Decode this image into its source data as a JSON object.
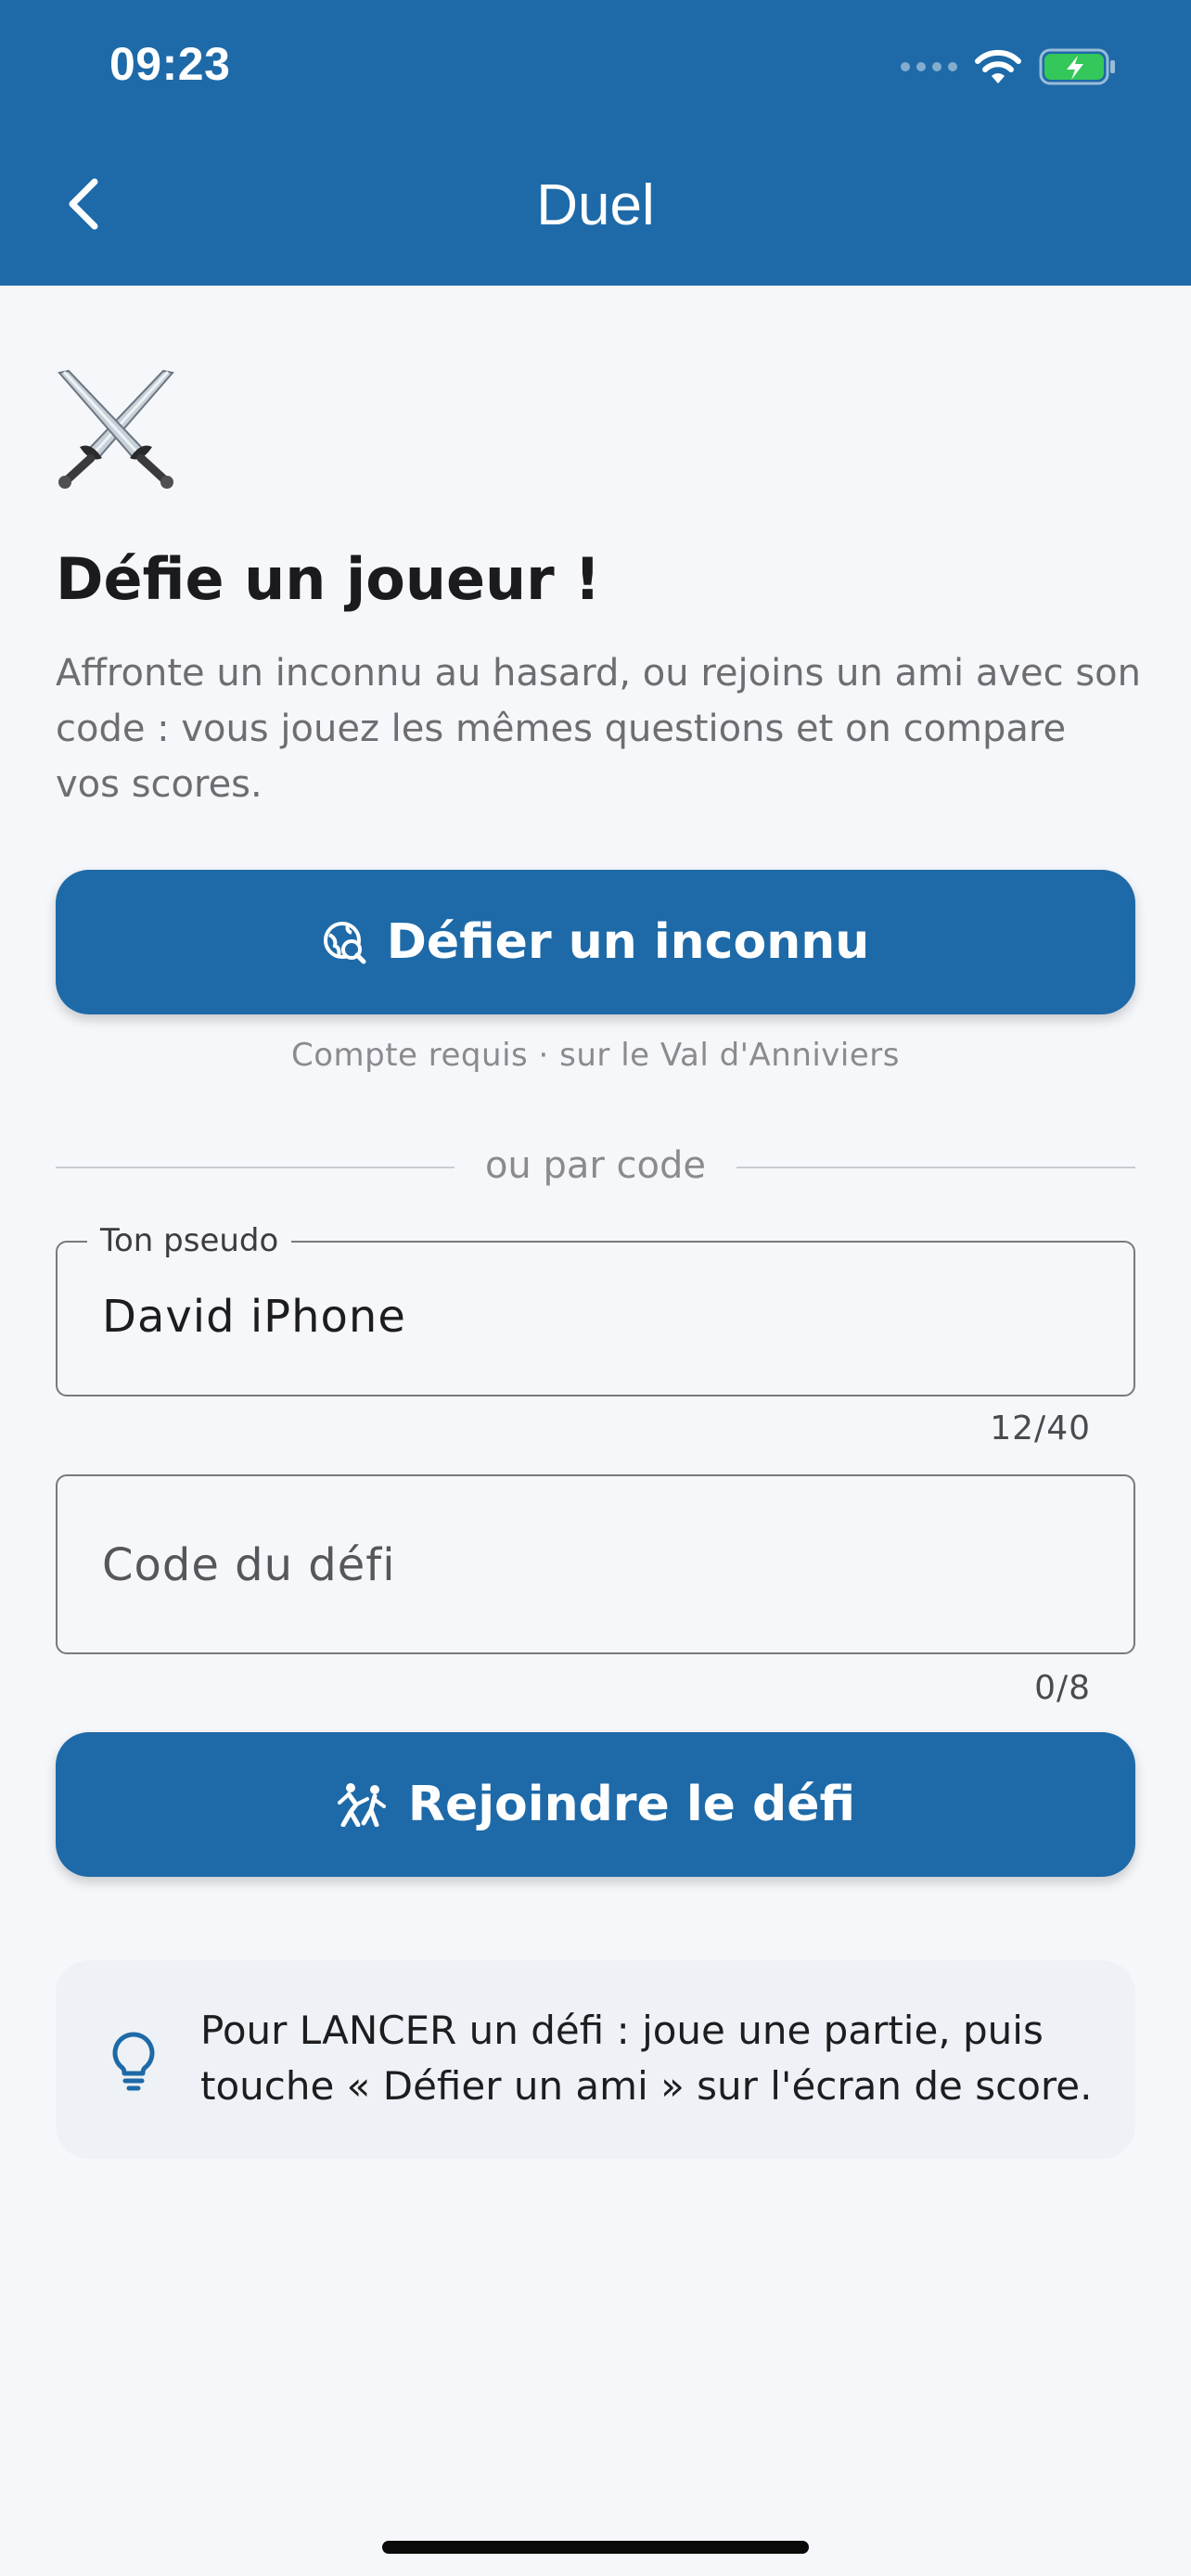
{
  "status_bar": {
    "time": "09:23",
    "icons": [
      "cellular-signal-icon",
      "wifi-icon",
      "battery-charging-icon"
    ]
  },
  "nav": {
    "title": "Duel",
    "back_icon": "chevron-left-icon"
  },
  "hero": {
    "icon": "crossed-swords-icon",
    "title": "Défie un joueur !",
    "description": "Affronte un inconnu au hasard, ou rejoins un ami avec son code : vous jouez les mêmes questions et on compare vos scores."
  },
  "random_challenge": {
    "button_label": "Défier un inconnu",
    "button_icon": "travel-explore-icon",
    "note": "Compte requis · sur le Val d'Anniviers"
  },
  "divider_text": "ou par code",
  "pseudo_field": {
    "label": "Ton pseudo",
    "value": "David iPhone",
    "counter": "12/40"
  },
  "code_field": {
    "placeholder": "Code du défi",
    "counter": "0/8"
  },
  "join_challenge": {
    "button_label": "Rejoindre le défi",
    "button_icon": "sports-kabaddi-icon"
  },
  "tip": {
    "icon": "lightbulb-icon",
    "text": "Pour LANCER un défi : joue une partie, puis touche « Défier un ami » sur l'écran de score."
  },
  "colors": {
    "primary": "#1e6aa8",
    "background": "#f5f7fa",
    "tip_background": "#eef1f5",
    "battery": "#34c759"
  }
}
